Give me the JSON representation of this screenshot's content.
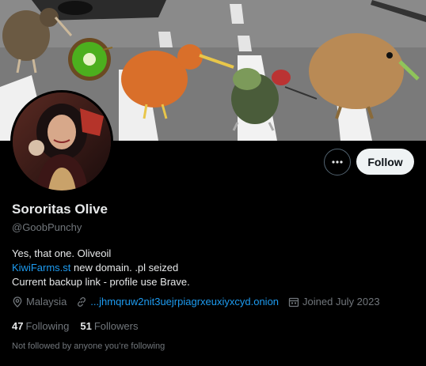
{
  "profile": {
    "display_name": "Sororitas Olive",
    "handle": "@GoobPunchy",
    "follow_label": "Follow",
    "more_icon": "more-horizontal-icon"
  },
  "bio": {
    "line1": "Yes, that one. Oliveoil",
    "link_text": "KiwiFarms.st",
    "line2_rest": " new domain. .pl seized",
    "line3": "Current backup link - profile use Brave."
  },
  "meta": {
    "location": "Malaysia",
    "location_icon": "location-pin-icon",
    "url": "...jhmqruw2nit3uejrpiagrxeuxiyxcyd.onion",
    "url_icon": "link-icon",
    "joined": "Joined July 2023",
    "joined_icon": "calendar-icon"
  },
  "stats": {
    "following_count": "47",
    "following_label": "Following",
    "followers_count": "51",
    "followers_label": "Followers"
  },
  "followed_note": "Not followed by anyone you’re following",
  "colors": {
    "background": "#000000",
    "text_primary": "#e7e9ea",
    "text_secondary": "#71767b",
    "link": "#1d9bf0",
    "follow_button_bg": "#eff3f4"
  }
}
